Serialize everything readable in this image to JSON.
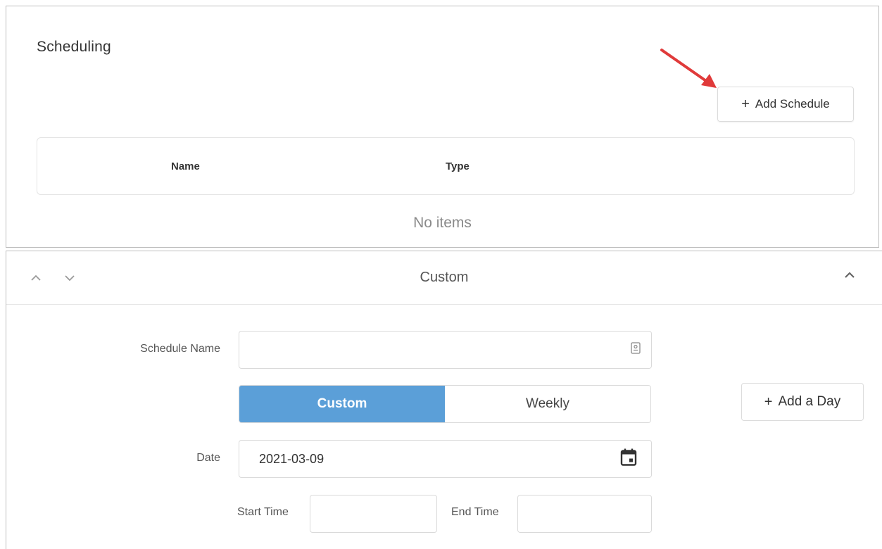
{
  "scheduling": {
    "title": "Scheduling",
    "add_button": {
      "icon": "plus-icon",
      "label": "Add Schedule"
    },
    "table": {
      "columns": [
        "Name",
        "Type"
      ],
      "empty_message": "No items"
    }
  },
  "editor": {
    "header_title": "Custom",
    "icons": {
      "move_up": "chevron-up-icon",
      "move_down": "chevron-down-icon",
      "collapse": "chevron-up-icon"
    },
    "schedule_name": {
      "label": "Schedule Name",
      "value": "",
      "icon": "contact-card-icon"
    },
    "type_toggle": {
      "options": [
        "Custom",
        "Weekly"
      ],
      "selected": "Custom"
    },
    "add_day_button": {
      "icon": "plus-icon",
      "label": "Add a Day"
    },
    "date": {
      "label": "Date",
      "value": "2021-03-09",
      "icon": "calendar-icon"
    },
    "start_time": {
      "label": "Start Time",
      "value": ""
    },
    "end_time": {
      "label": "End Time",
      "value": ""
    }
  },
  "colors": {
    "accent": "#5b9fd8",
    "annotation_arrow": "#e03a3a",
    "border": "#dadada"
  }
}
